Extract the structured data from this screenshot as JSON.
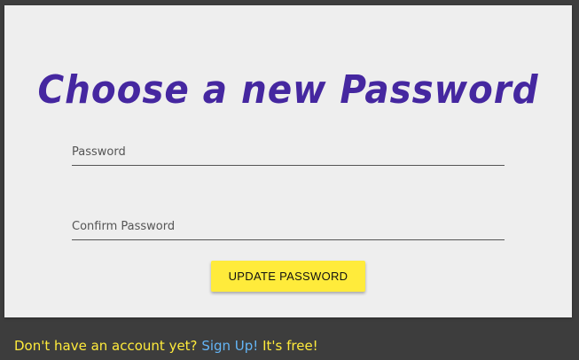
{
  "heading": "Choose a new Password",
  "form": {
    "password_placeholder": "Password",
    "confirm_placeholder": "Confirm Password",
    "submit_label": "UPDATE PASSWORD"
  },
  "footer": {
    "prompt": "Don't have an account yet?",
    "signup_link": "Sign Up!",
    "suffix": "It's free!"
  },
  "colors": {
    "page_background": "#3d3d3d",
    "card_background": "#eeeeee",
    "heading": "#4527a0",
    "button": "#ffeb3b",
    "footer_text": "#ffeb3b",
    "link": "#64b5f6"
  }
}
